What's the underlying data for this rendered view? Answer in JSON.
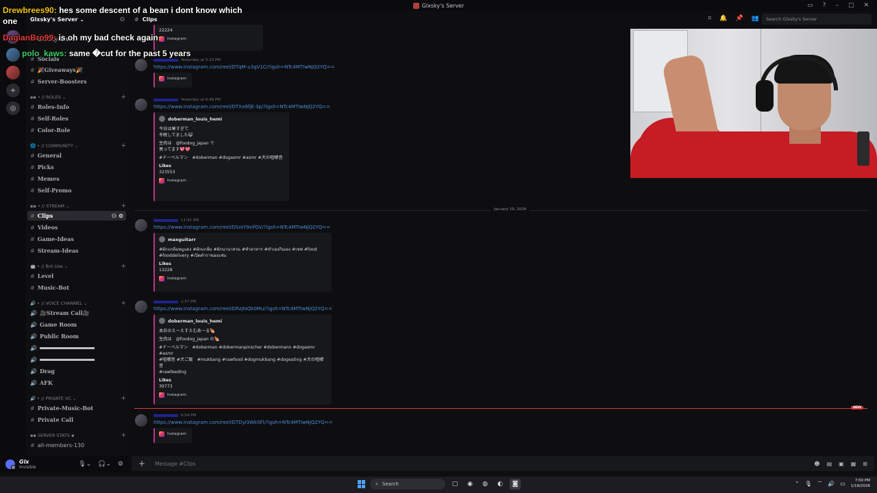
{
  "window": {
    "title": "Glxsky's Server"
  },
  "server": {
    "name": "Glxsky's Server"
  },
  "sidebar": {
    "partial_items": [
      "Glxsky-Lives",
      "Socials"
    ],
    "giveaways": "🎉Giveaways🎉",
    "server_boosters": "Server-Boosters",
    "categories": {
      "roles": "// ROLES",
      "community": "// COMMUNITY",
      "stream": "// STREAM",
      "bot_use": "// Bot Use",
      "voice": "// VOICE CHANNEL",
      "private_vc": "// PRIVATE VC",
      "server_stats": "SERVER STATS"
    },
    "roles_channels": [
      "Roles-Info",
      "Self-Roles",
      "Color-Role"
    ],
    "community_channels": [
      "General",
      "Picks",
      "Memes",
      "Self-Promo"
    ],
    "stream_channels": [
      "Clips",
      "Videos",
      "Game-Ideas",
      "Stream-Ideas"
    ],
    "bot_channels": [
      "Level",
      "Music-Bot"
    ],
    "voice_channels": [
      "🎥Stream Call🎥",
      "Game Room",
      "Public Room",
      "",
      "",
      "Drag",
      "AFK"
    ],
    "private_channels": [
      "Private-Music-Bot",
      "Private Call"
    ],
    "stats_channels": [
      "all-members-130"
    ]
  },
  "user": {
    "name": "Glx",
    "status": "Invisible"
  },
  "channel": {
    "name": "Clips",
    "composer_placeholder": "Message #Clips"
  },
  "search": {
    "placeholder": "Search Glxsky's Server"
  },
  "messages": [
    {
      "time": "",
      "link": "",
      "embed_value": "22224",
      "footer": "Instagram"
    },
    {
      "time": "Yesterday at 5:20 PM",
      "link": "https://www.instagram.com/reel/DTqM-u3gV1C/?igsh=NTc4MTIwNjQ2YQ==",
      "footer": "Instagram"
    },
    {
      "time": "Yesterday at 6:48 PM",
      "link": "https://www.instagram.com/reel/DTXa9fjE-3p/?igsh=NTc4MTIwNjQ2YQ==",
      "embed_author": "doberman_louis_hemi",
      "embed_text": [
        "今日は寒すぎて",
        "冬眠してました😺",
        "",
        "生肉は　@foodog_japan で",
        "買ってます💖💖",
        "",
        "#ドーベルマン　#doberman #dogasmr #asmr #犬の咀嚼音"
      ],
      "field_name": "Likes",
      "field_value": "323553",
      "footer": "Instagram"
    },
    {
      "time": "11:41 AM",
      "link": "https://www.instagram.com/reel/DSnIY9xifOV/?igsh=NTc4MTIwNjQ2YQ==",
      "embed_author": "maxguitarr",
      "embed_text": [
        "#ผักแกล้มหมูแดง #ผักแกล้ม #ผักนานาสวน #ทำอาหาร #ทำเองกินเอง #เชฟ #food",
        "#fooddelivery #เปิดตำราของแซ่บ"
      ],
      "field_name": "Likes",
      "field_value": "13228",
      "footer": "Instagram"
    },
    {
      "time": "2:57 PM",
      "link": "https://www.instagram.com/reel/DRzjtsQk0Mu/?igsh=NTc4MTIwNjQ2YQ==",
      "embed_author": "doberman_louis_hemi",
      "embed_text": [
        "本日のえーえすえむあーる🍖",
        "",
        "生肉は　@foodog_japan の🍖",
        "",
        "#ドーベルマン　#doberman #dobermanpinscher #dobermann #dogasmr #asmr",
        "#咀嚼音 #犬ご飯　#mukbang #rawfood #dogmukbang #dogeating #犬の咀嚼音",
        "#rawfeeding"
      ],
      "field_name": "Likes",
      "field_value": "39773",
      "footer": "Instagram"
    },
    {
      "time": "6:54 PM",
      "link": "https://www.instagram.com/reel/DTDyi3WkSFl/?igsh=NTc4MTIwNjQ2YQ==",
      "footer": "Instagram"
    }
  ],
  "date_divider": "January 19, 2026",
  "new_badge": "NEW",
  "stream_chat": [
    {
      "user": "Drewbrees90:",
      "text": "hes some descent of a bean i dont know which",
      "color": "#f5c518"
    },
    {
      "user": "",
      "text": "one",
      "color": "#ffffff"
    },
    {
      "user": "DagianBro99:",
      "text": "is oh my bad check again",
      "color": "#e83c3c"
    },
    {
      "user": "polo_kaws:",
      "text": "same �cut for the past 5 years",
      "color": "#3fd26b"
    }
  ],
  "taskbar": {
    "search": "Search",
    "time": "7:50 PM",
    "date": "1/19/2026"
  },
  "colors": {
    "accent": "#5865f2",
    "link": "#4c8dd8",
    "embed_border": "#c1328f",
    "new": "#d83c3e"
  }
}
